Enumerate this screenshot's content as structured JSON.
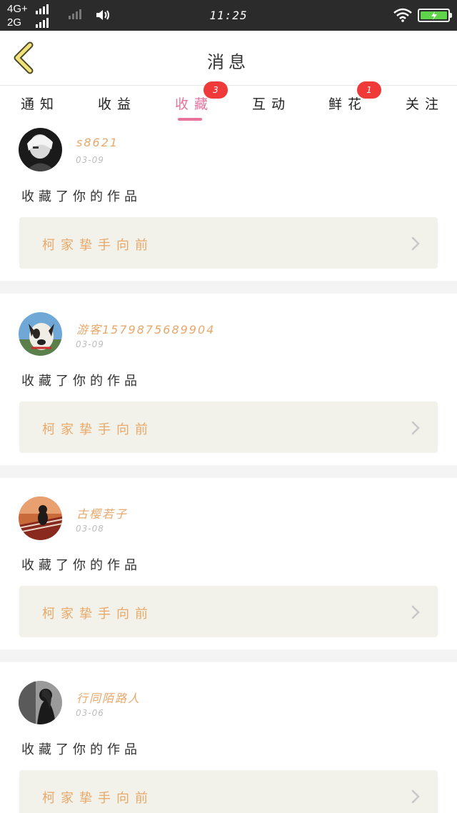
{
  "status_bar": {
    "network_1": "4G+",
    "network_2": "2G",
    "time": "11:25",
    "icons": [
      "signal-icon",
      "signal-weak-icon",
      "speaker-icon",
      "wifi-icon",
      "battery-charging-icon"
    ],
    "battery_color": "#5fd34a"
  },
  "header": {
    "title": "消息",
    "back_icon": "chevron-left-icon",
    "back_color": "#f1e27a"
  },
  "tabs": [
    {
      "label": "通知",
      "active": false
    },
    {
      "label": "收益",
      "active": false
    },
    {
      "label": "收藏",
      "active": true,
      "badge": "3"
    },
    {
      "label": "互动",
      "active": false
    },
    {
      "label": "鲜花",
      "active": false,
      "badge": "1"
    },
    {
      "label": "关注",
      "active": false
    }
  ],
  "colors": {
    "accent": "#e8739c",
    "badge": "#f03a3a",
    "username": "#e8a86a",
    "work_box": "#f2f2ea"
  },
  "messages": [
    {
      "user": "s8621",
      "date": "03-09",
      "action": "收藏了你的作品",
      "work_title": "柯家挚手向前",
      "avatar_icon": "avatar-icon"
    },
    {
      "user": "游客1579875689904",
      "date": "03-09",
      "action": "收藏了你的作品",
      "work_title": "柯家挚手向前",
      "avatar_icon": "avatar-icon"
    },
    {
      "user": "古樱若子",
      "date": "03-08",
      "action": "收藏了你的作品",
      "work_title": "柯家挚手向前",
      "avatar_icon": "avatar-icon"
    },
    {
      "user": "行同陌路人",
      "date": "03-06",
      "action": "收藏了你的作品",
      "work_title": "柯家挚手向前",
      "avatar_icon": "avatar-icon"
    }
  ]
}
